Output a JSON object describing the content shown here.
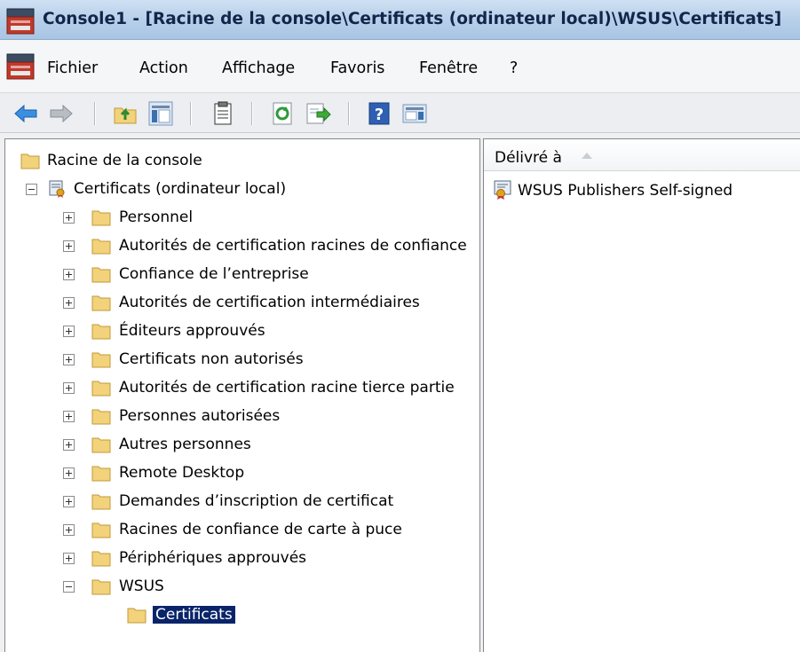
{
  "window": {
    "title": "Console1 - [Racine de la console\\Certificats (ordinateur local)\\WSUS\\Certificats]"
  },
  "menu": {
    "items": [
      "Fichier",
      "Action",
      "Affichage",
      "Favoris",
      "Fenêtre",
      "?"
    ]
  },
  "toolbar": {
    "buttons": [
      "back-arrow-icon",
      "forward-arrow-icon",
      "up-folder-icon",
      "show-hide-tree-icon",
      "properties-icon",
      "refresh-icon",
      "export-list-icon",
      "help-icon",
      "action-pane-icon"
    ]
  },
  "tree": {
    "root": "Racine de la console",
    "store": "Certificats (ordinateur local)",
    "folders": [
      "Personnel",
      "Autorités de certification racines de confiance",
      "Confiance de l’entreprise",
      "Autorités de certification intermédiaires",
      "Éditeurs approuvés",
      "Certificats non autorisés",
      "Autorités de certification racine tierce partie",
      "Personnes autorisées",
      "Autres personnes",
      "Remote Desktop",
      "Demandes d’inscription de certificat",
      "Racines de confiance de carte à puce",
      "Périphériques approuvés",
      "WSUS"
    ],
    "selected": "Certificats"
  },
  "list": {
    "column": "Délivré à",
    "items": [
      "WSUS Publishers Self-signed"
    ]
  },
  "colors": {
    "title_text": "#13254a",
    "selection": "#0a246a",
    "folder": "#f2d27a"
  }
}
